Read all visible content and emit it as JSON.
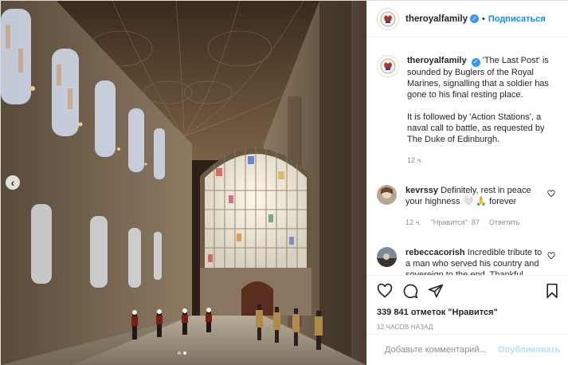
{
  "profile": {
    "username": "theroyalfamily",
    "follow_label": "Подписаться",
    "separator": "•"
  },
  "caption": {
    "username": "theroyalfamily",
    "paragraph1": "'The Last Post' is sounded by Buglers of the Royal Marines, signalling that a soldier has gone to his final resting place.",
    "paragraph2": "It is followed by 'Action Stations', a naval call to battle, as requested by The Duke of Edinburgh.",
    "time": "12 ч."
  },
  "comments": [
    {
      "username": "kevrssy",
      "text": "Definitely, rest in peace your highness 🤍 🙏 forever",
      "time": "12 ч.",
      "likes": "\"Нравится\": 87",
      "reply": "Ответить"
    },
    {
      "username": "rebeccacorish",
      "text": "Incredible tribute to a man who served his country and sovereign to the end. Thankful. Proud to be British. A"
    }
  ],
  "actions": {
    "likes": "339 841 отметок \"Нравится\"",
    "posted": "12 ЧАСОВ НАЗАД"
  },
  "add_comment": {
    "placeholder": "Добавьте комментарий...",
    "publish_label": "Опубликовать"
  },
  "colors": {
    "link_blue": "#0095f6",
    "verified_blue": "#3897f0",
    "publish_disabled": "#b2dffc",
    "muted": "#8e8e8e"
  },
  "carousel": {
    "total": 2,
    "current": 2
  }
}
